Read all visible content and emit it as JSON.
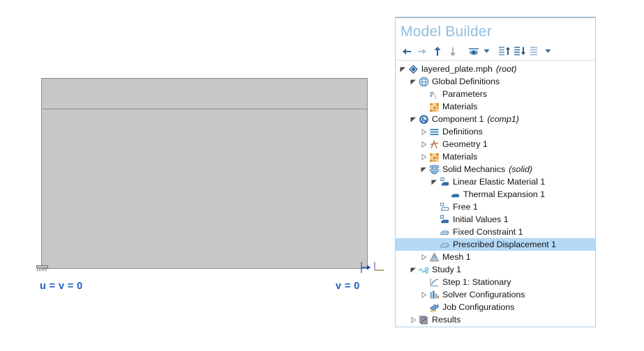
{
  "graphics": {
    "name": "geometry-view",
    "plate": {
      "layers": [
        {
          "name": "top-layer"
        },
        {
          "name": "bottom-layer"
        }
      ]
    },
    "labels": {
      "left_constraint": "u = v = 0",
      "right_constraint": "v = 0",
      "color": "#1f5fc4"
    },
    "symbols": {
      "fixed_constraint": "fixed-constraint-hatch-icon",
      "prescribed_displacement": "prescribed-displacement-arrow-icon",
      "axis_triad": "axis-triad-icon"
    }
  },
  "model_builder": {
    "title": "Model Builder",
    "title_color": "#8fc0de",
    "toolbar": [
      {
        "name": "go-back-button",
        "icon": "arrow-left-icon"
      },
      {
        "name": "go-forward-button",
        "icon": "arrow-right-icon"
      },
      {
        "name": "move-up-button",
        "icon": "arrow-up-icon"
      },
      {
        "name": "move-down-button",
        "icon": "arrow-down-icon"
      },
      {
        "name": "show-hide-button",
        "icon": "eye-icon"
      },
      {
        "name": "show-hide-dropdown",
        "icon": "chevron-down-icon"
      },
      {
        "name": "expand-tree-button",
        "icon": "list-expand-icon"
      },
      {
        "name": "collapse-tree-button",
        "icon": "list-collapse-icon"
      },
      {
        "name": "list-options-button",
        "icon": "list-icon"
      },
      {
        "name": "list-options-dropdown",
        "icon": "chevron-down-icon"
      }
    ],
    "tree": [
      {
        "label": "layered_plate.mph",
        "sub": "(root)",
        "indent": 0,
        "twisty": "expanded",
        "icon": "root-diamond-icon",
        "selected": false
      },
      {
        "label": "Global Definitions",
        "sub": "",
        "indent": 1,
        "twisty": "expanded",
        "icon": "globe-icon",
        "selected": false
      },
      {
        "label": "Parameters",
        "sub": "",
        "indent": 2,
        "twisty": "none",
        "icon": "parameters-pi-icon",
        "selected": false
      },
      {
        "label": "Materials",
        "sub": "",
        "indent": 2,
        "twisty": "none",
        "icon": "materials-grid-icon",
        "selected": false
      },
      {
        "label": "Component 1",
        "sub": "(comp1)",
        "indent": 1,
        "twisty": "expanded",
        "icon": "component-icon",
        "selected": false
      },
      {
        "label": "Definitions",
        "sub": "",
        "indent": 2,
        "twisty": "collapsed",
        "icon": "definitions-lines-icon",
        "selected": false
      },
      {
        "label": "Geometry 1",
        "sub": "",
        "indent": 2,
        "twisty": "collapsed",
        "icon": "geometry-icon",
        "selected": false
      },
      {
        "label": "Materials",
        "sub": "",
        "indent": 2,
        "twisty": "collapsed",
        "icon": "materials-grid-icon",
        "selected": false
      },
      {
        "label": "Solid Mechanics",
        "sub": "(solid)",
        "indent": 2,
        "twisty": "expanded",
        "icon": "solid-mechanics-icon",
        "selected": false
      },
      {
        "label": "Linear Elastic Material 1",
        "sub": "",
        "indent": 3,
        "twisty": "expanded",
        "icon": "linear-elastic-icon",
        "selected": false
      },
      {
        "label": "Thermal Expansion 1",
        "sub": "",
        "indent": 4,
        "twisty": "none",
        "icon": "thermal-expansion-icon",
        "selected": false
      },
      {
        "label": "Free 1",
        "sub": "",
        "indent": 3,
        "twisty": "none",
        "icon": "free-boundary-icon",
        "selected": false
      },
      {
        "label": "Initial Values 1",
        "sub": "",
        "indent": 3,
        "twisty": "none",
        "icon": "initial-values-icon",
        "selected": false
      },
      {
        "label": "Fixed Constraint 1",
        "sub": "",
        "indent": 3,
        "twisty": "none",
        "icon": "fixed-constraint-icon",
        "selected": false
      },
      {
        "label": "Prescribed Displacement 1",
        "sub": "",
        "indent": 3,
        "twisty": "none",
        "icon": "prescribed-displacement-icon",
        "selected": true
      },
      {
        "label": "Mesh 1",
        "sub": "",
        "indent": 2,
        "twisty": "collapsed",
        "icon": "mesh-icon",
        "selected": false
      },
      {
        "label": "Study 1",
        "sub": "",
        "indent": 1,
        "twisty": "expanded",
        "icon": "study-icon",
        "selected": false
      },
      {
        "label": "Step 1: Stationary",
        "sub": "",
        "indent": 2,
        "twisty": "none",
        "icon": "stationary-step-icon",
        "selected": false
      },
      {
        "label": "Solver Configurations",
        "sub": "",
        "indent": 2,
        "twisty": "collapsed",
        "icon": "solver-icon",
        "selected": false
      },
      {
        "label": "Job Configurations",
        "sub": "",
        "indent": 2,
        "twisty": "none",
        "icon": "job-icon",
        "selected": false
      },
      {
        "label": "Results",
        "sub": "",
        "indent": 1,
        "twisty": "collapsed",
        "icon": "results-icon",
        "selected": false
      }
    ]
  }
}
